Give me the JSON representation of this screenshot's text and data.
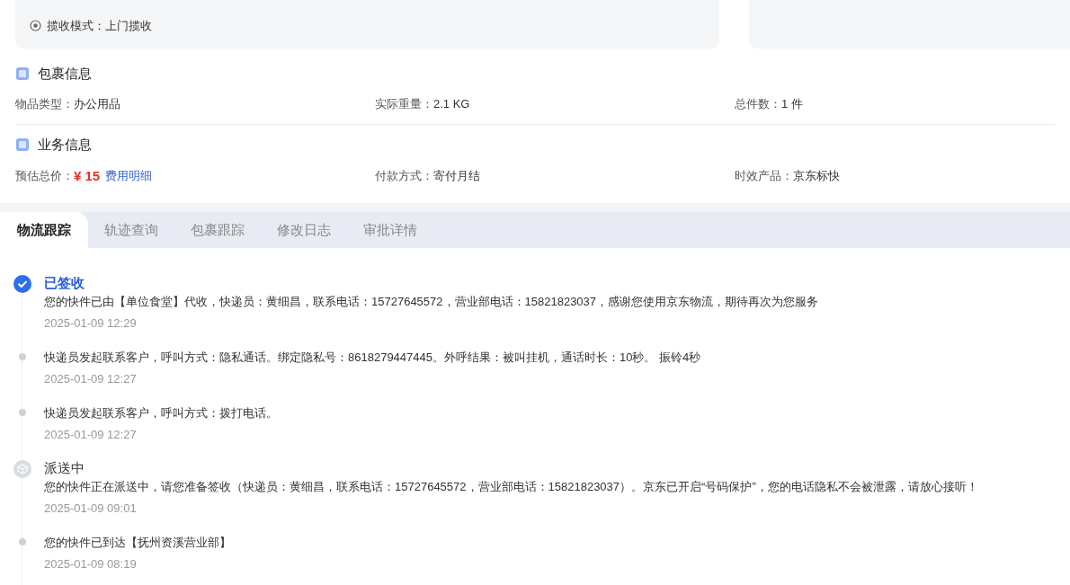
{
  "pickup": {
    "mode_label": "揽收模式：",
    "mode_value": "上门揽收"
  },
  "package": {
    "title": "包裹信息",
    "fields": [
      {
        "label": "物品类型：",
        "value": "办公用品"
      },
      {
        "label": "实际重量：",
        "value": "2.1 KG"
      },
      {
        "label": "总件数：",
        "value": "1 件"
      }
    ]
  },
  "business": {
    "title": "业务信息",
    "price_label": "预估总价：",
    "price": "¥ 15",
    "price_link": "费用明细",
    "fields": [
      {
        "label": "付款方式：",
        "value": "寄付月结"
      },
      {
        "label": "时效产品：",
        "value": "京东标快"
      }
    ]
  },
  "tabs": [
    {
      "label": "物流跟踪",
      "selected": true
    },
    {
      "label": "轨迹查询",
      "selected": false
    },
    {
      "label": "包裹跟踪",
      "selected": false
    },
    {
      "label": "修改日志",
      "selected": false
    },
    {
      "label": "审批详情",
      "selected": false
    }
  ],
  "timeline": [
    {
      "kind": "status",
      "current": true,
      "title": "已签收",
      "text": "您的快件已由【单位食堂】代收，快递员：黄细昌，联系电话：15727645572，营业部电话：15821823037，感谢您使用京东物流，期待再次为您服务",
      "time": "2025-01-09 12:29"
    },
    {
      "kind": "event",
      "text": "快递员发起联系客户，呼叫方式：隐私通话。绑定隐私号：8618279447445。外呼结果：被叫挂机，通话时长：10秒。 振铃4秒",
      "time": "2025-01-09 12:27"
    },
    {
      "kind": "event",
      "text": "快递员发起联系客户，呼叫方式：拨打电话。",
      "time": "2025-01-09 12:27"
    },
    {
      "kind": "status",
      "current": false,
      "title": "派送中",
      "text": "您的快件正在派送中，请您准备签收（快递员：黄细昌，联系电话：15727645572，营业部电话：15821823037）。京东已开启“号码保护”，您的电话隐私不会被泄露，请放心接听！",
      "time": "2025-01-09 09:01"
    },
    {
      "kind": "event",
      "text": "您的快件已到达【抚州资溪营业部】",
      "time": "2025-01-09 08:19"
    }
  ]
}
